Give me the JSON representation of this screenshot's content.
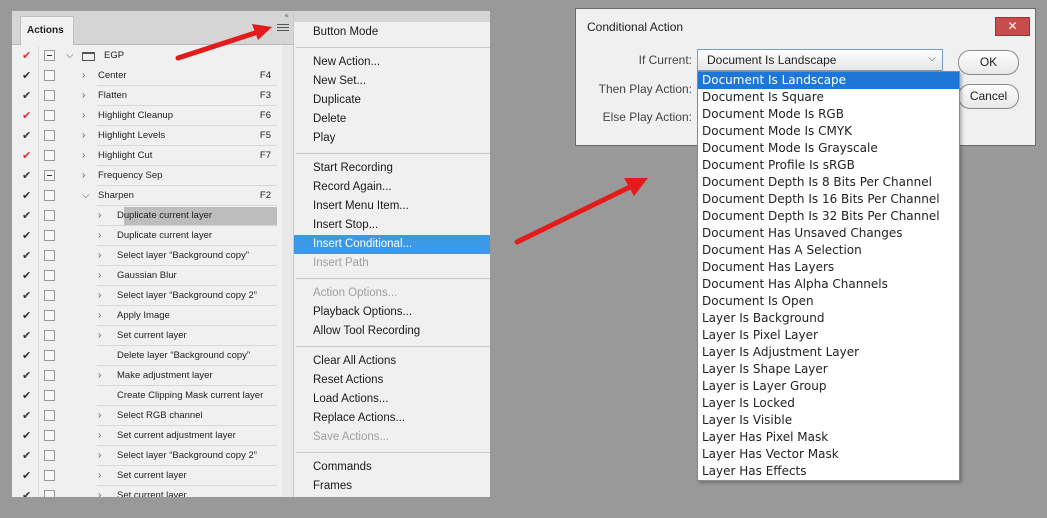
{
  "panel": {
    "tab_label": "Actions",
    "collapse_glyph": "«",
    "rows": [
      {
        "check": "red",
        "dialog": true,
        "twisty": "⌵",
        "indent": 0,
        "label": "EGP",
        "fkey": "",
        "folder": true
      },
      {
        "check": "dark",
        "dialog": false,
        "twisty": "›",
        "indent": 1,
        "label": "Center",
        "fkey": "F4"
      },
      {
        "check": "dark",
        "dialog": false,
        "twisty": "›",
        "indent": 1,
        "label": "Flatten",
        "fkey": "F3"
      },
      {
        "check": "red",
        "dialog": false,
        "twisty": "›",
        "indent": 1,
        "label": "Highlight Cleanup",
        "fkey": "F6"
      },
      {
        "check": "dark",
        "dialog": false,
        "twisty": "›",
        "indent": 1,
        "label": "Highlight Levels",
        "fkey": "F5"
      },
      {
        "check": "red",
        "dialog": false,
        "twisty": "›",
        "indent": 1,
        "label": "Highlight Cut",
        "fkey": "F7"
      },
      {
        "check": "dark",
        "dialog": true,
        "twisty": "›",
        "indent": 1,
        "label": "Frequency Sep",
        "fkey": ""
      },
      {
        "check": "dark",
        "dialog": false,
        "twisty": "⌵",
        "indent": 1,
        "label": "Sharpen",
        "fkey": "F2"
      },
      {
        "check": "dark",
        "dialog": false,
        "twisty": "›",
        "indent": 2,
        "label": "Duplicate current layer",
        "fkey": "",
        "selected": true
      },
      {
        "check": "dark",
        "dialog": false,
        "twisty": "›",
        "indent": 2,
        "label": "Duplicate current layer",
        "fkey": ""
      },
      {
        "check": "dark",
        "dialog": false,
        "twisty": "›",
        "indent": 2,
        "label": "Select layer “Background copy”",
        "fkey": ""
      },
      {
        "check": "dark",
        "dialog": false,
        "twisty": "›",
        "indent": 2,
        "label": "Gaussian Blur",
        "fkey": ""
      },
      {
        "check": "dark",
        "dialog": false,
        "twisty": "›",
        "indent": 2,
        "label": "Select layer “Background copy 2”",
        "fkey": ""
      },
      {
        "check": "dark",
        "dialog": false,
        "twisty": "›",
        "indent": 2,
        "label": "Apply Image",
        "fkey": ""
      },
      {
        "check": "dark",
        "dialog": false,
        "twisty": "›",
        "indent": 2,
        "label": "Set current layer",
        "fkey": ""
      },
      {
        "check": "dark",
        "dialog": false,
        "twisty": "",
        "indent": 2,
        "label": "Delete layer “Background copy”",
        "fkey": ""
      },
      {
        "check": "dark",
        "dialog": false,
        "twisty": "›",
        "indent": 2,
        "label": "Make adjustment layer",
        "fkey": ""
      },
      {
        "check": "dark",
        "dialog": false,
        "twisty": "",
        "indent": 2,
        "label": "Create Clipping Mask current layer",
        "fkey": ""
      },
      {
        "check": "dark",
        "dialog": false,
        "twisty": "›",
        "indent": 2,
        "label": "Select RGB channel",
        "fkey": ""
      },
      {
        "check": "dark",
        "dialog": false,
        "twisty": "›",
        "indent": 2,
        "label": "Set current adjustment layer",
        "fkey": ""
      },
      {
        "check": "dark",
        "dialog": false,
        "twisty": "›",
        "indent": 2,
        "label": "Select layer “Background copy 2”",
        "fkey": ""
      },
      {
        "check": "dark",
        "dialog": false,
        "twisty": "›",
        "indent": 2,
        "label": "Set current layer",
        "fkey": ""
      },
      {
        "check": "dark",
        "dialog": false,
        "twisty": "›",
        "indent": 2,
        "label": "Set current layer",
        "fkey": ""
      }
    ]
  },
  "menu": {
    "groups": [
      [
        {
          "label": "Button Mode",
          "disabled": false
        }
      ],
      [
        {
          "label": "New Action...",
          "disabled": false
        },
        {
          "label": "New Set...",
          "disabled": false
        },
        {
          "label": "Duplicate",
          "disabled": false
        },
        {
          "label": "Delete",
          "disabled": false
        },
        {
          "label": "Play",
          "disabled": false
        }
      ],
      [
        {
          "label": "Start Recording",
          "disabled": false
        },
        {
          "label": "Record Again...",
          "disabled": false
        },
        {
          "label": "Insert Menu Item...",
          "disabled": false
        },
        {
          "label": "Insert Stop...",
          "disabled": false
        },
        {
          "label": "Insert Conditional...",
          "disabled": false,
          "highlight": true
        },
        {
          "label": "Insert Path",
          "disabled": true
        }
      ],
      [
        {
          "label": "Action Options...",
          "disabled": true
        },
        {
          "label": "Playback Options...",
          "disabled": false
        },
        {
          "label": "Allow Tool Recording",
          "disabled": false
        }
      ],
      [
        {
          "label": "Clear All Actions",
          "disabled": false
        },
        {
          "label": "Reset Actions",
          "disabled": false
        },
        {
          "label": "Load Actions...",
          "disabled": false
        },
        {
          "label": "Replace Actions...",
          "disabled": false
        },
        {
          "label": "Save Actions...",
          "disabled": true
        }
      ],
      [
        {
          "label": "Commands",
          "disabled": false
        },
        {
          "label": "Frames",
          "disabled": false
        }
      ]
    ]
  },
  "dialog": {
    "title": "Conditional Action",
    "close_glyph": "✕",
    "if_current_label": "If Current:",
    "then_label": "Then Play Action:",
    "else_label": "Else Play Action:",
    "if_current_value": "Document Is Landscape",
    "ok_label": "OK",
    "cancel_label": "Cancel"
  },
  "dropdown": {
    "selected_index": 0,
    "options": [
      "Document Is Landscape",
      "Document Is Square",
      "Document Mode Is RGB",
      "Document Mode Is CMYK",
      "Document Mode Is Grayscale",
      "Document Profile Is sRGB",
      "Document Depth Is 8 Bits Per Channel",
      "Document Depth Is 16 Bits Per Channel",
      "Document Depth Is 32 Bits Per Channel",
      "Document Has Unsaved Changes",
      "Document Has A Selection",
      "Document Has Layers",
      "Document Has Alpha Channels",
      "Document Is Open",
      "Layer Is Background",
      "Layer Is Pixel Layer",
      "Layer Is Adjustment Layer",
      "Layer Is Shape Layer",
      "Layer is Layer Group",
      "Layer Is Locked",
      "Layer Is Visible",
      "Layer Has Pixel Mask",
      "Layer Has Vector Mask",
      "Layer Has Effects"
    ]
  },
  "colors": {
    "highlight": "#3b99e8",
    "dropdown_selected": "#1e77d8",
    "arrow": "#e41b1b",
    "check_red": "#e03030"
  }
}
